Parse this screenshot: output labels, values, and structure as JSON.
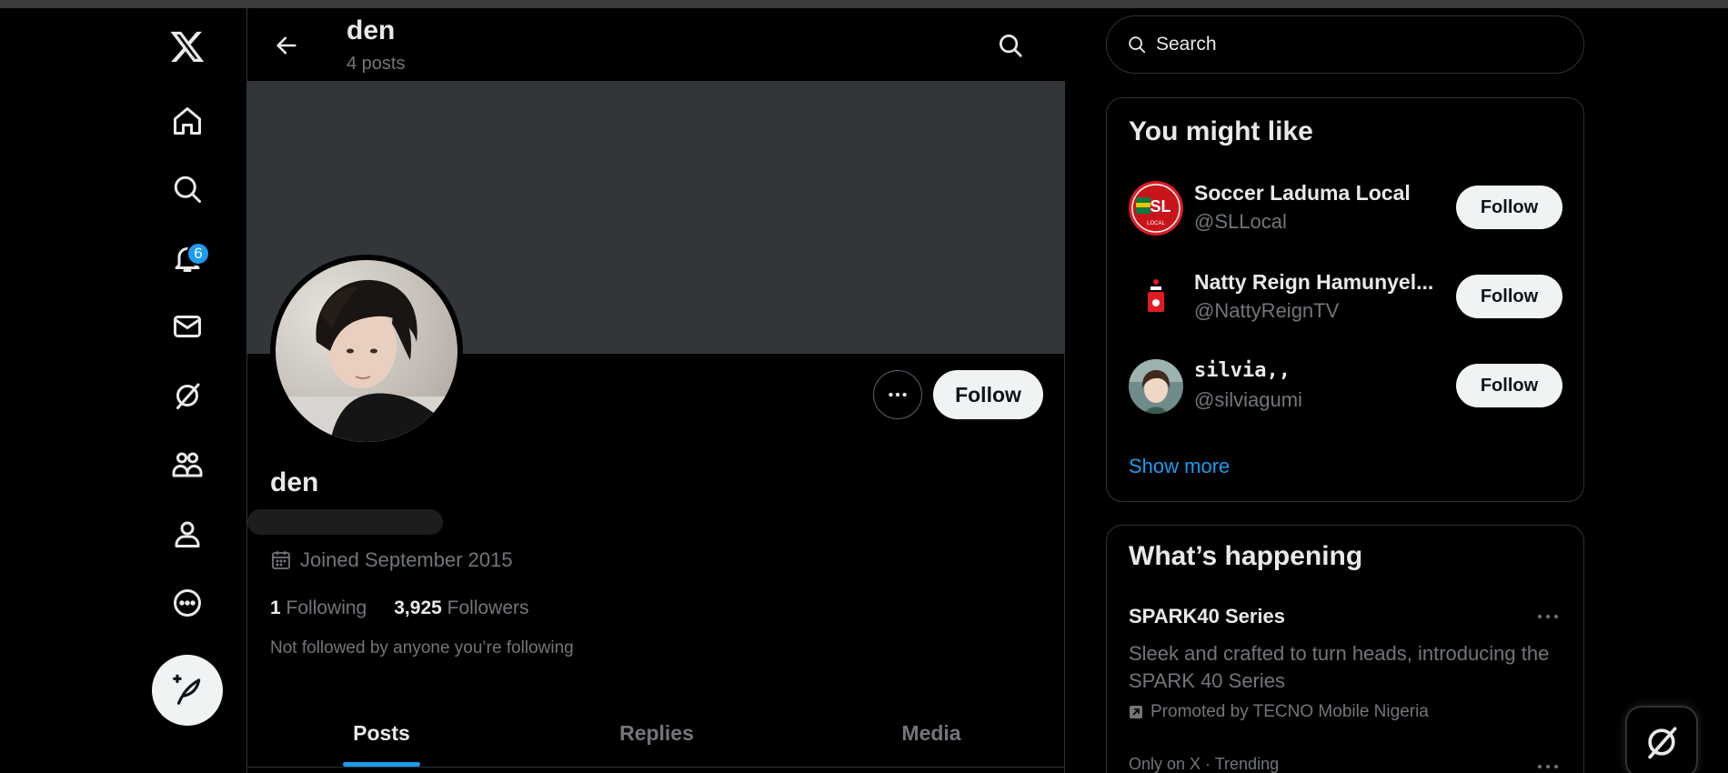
{
  "nav": {
    "notification_count": "6"
  },
  "header": {
    "name": "den",
    "post_count": "4 posts"
  },
  "profile": {
    "display_name": "den",
    "joined": "Joined September 2015",
    "following_count": "1",
    "following_label": "Following",
    "followers_count": "3,925",
    "followers_label": "Followers",
    "not_followed_text": "Not followed by anyone you’re following",
    "follow_label": "Follow"
  },
  "tabs": [
    {
      "label": "Posts"
    },
    {
      "label": "Replies"
    },
    {
      "label": "Media"
    }
  ],
  "search": {
    "placeholder": "Search"
  },
  "you_might_like": {
    "title": "You might like",
    "users": [
      {
        "name": "Soccer Laduma Local",
        "handle": "@SLLocal",
        "follow_label": "Follow",
        "avatar_text": "SL",
        "avatar_subtext": "LOCAL"
      },
      {
        "name": "Natty Reign Hamunyel...",
        "handle": "@NattyReignTV",
        "follow_label": "Follow"
      },
      {
        "name": "silvia,,",
        "handle": "@silviagumi",
        "follow_label": "Follow"
      }
    ],
    "show_more": "Show more"
  },
  "whats_happening": {
    "title": "What’s happening",
    "trend_title": "SPARK40 Series",
    "trend_desc": "Sleek and crafted to turn heads, introducing the SPARK 40 Series",
    "promoted": "Promoted by TECNO Mobile Nigeria",
    "trend2_meta": "Only on X · Trending"
  }
}
